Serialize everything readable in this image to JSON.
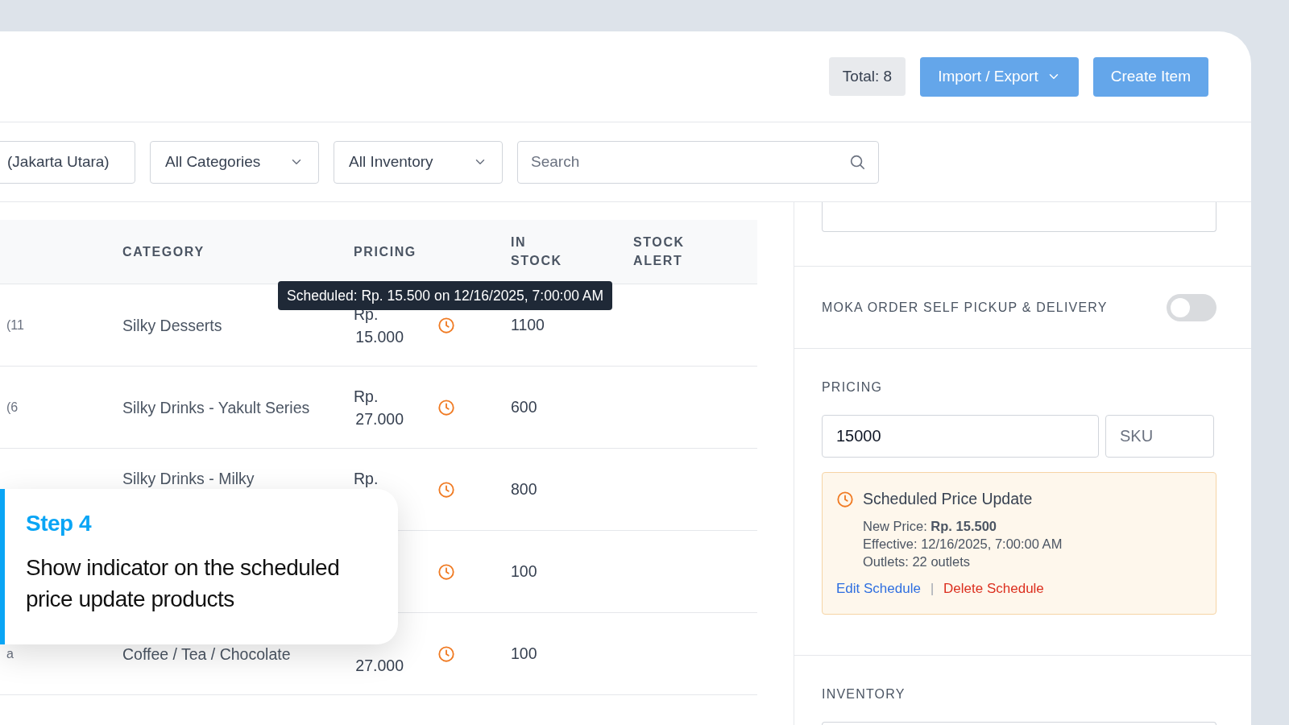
{
  "header": {
    "total": "Total: 8",
    "buttons": [
      {
        "label": "Import / Export",
        "kind": "dropdown"
      },
      {
        "label": "Create Item",
        "kind": "plain"
      }
    ]
  },
  "filters": {
    "selects": [
      {
        "label": "(Jakarta Utara)",
        "kind": "plain"
      },
      {
        "label": "All Categories",
        "kind": "dropdown"
      },
      {
        "label": "All Inventory",
        "kind": "dropdown"
      }
    ],
    "search": {
      "placeholder": "Search"
    }
  },
  "table": {
    "columns": [
      "CATEGORY",
      "PRICING",
      "IN STOCK",
      "STOCK ALERT"
    ],
    "rows": [
      {
        "column_1": "(11",
        "category": "Silky Desserts",
        "pricing": {
          "line_1": "Rp.",
          "line_2": "15.000"
        },
        "scheduled": true,
        "in_stock": "1100"
      },
      {
        "column_1": "(6",
        "category": "Silky Drinks - Yakult Series",
        "pricing": {
          "line_1": "Rp.",
          "line_2": "27.000"
        },
        "scheduled": true,
        "in_stock": "600"
      },
      {
        "category": "Silky Drinks - Milky",
        "pricing": {
          "line_1": "Rp."
        },
        "scheduled": true,
        "in_stock": "800"
      },
      {
        "scheduled": true,
        "in_stock": "100"
      },
      {
        "column_1": "a",
        "category": "Coffee / Tea / Chocolate",
        "pricing": {
          "line_2": "27.000"
        },
        "scheduled": true,
        "in_stock": "100"
      }
    ],
    "tooltip": {
      "text": "Scheduled: Rp. 15.500 on 12/16/2025, 7:00:00 AM"
    }
  },
  "panel": {
    "toggle": {
      "label": "MOKA ORDER SELF PICKUP & DELIVERY",
      "on": false
    },
    "pricing": {
      "label": "PRICING",
      "price_value": "15000",
      "sku_placeholder": "SKU",
      "schedule": {
        "title": "Scheduled Price Update",
        "lines": [
          "New Price: **Rp. 15.500**",
          "Effective: 12/16/2025, 7:00:00 AM",
          "Outlets: 22 outlets"
        ],
        "separator": "|",
        "actions": [
          {
            "label": "Edit Schedule",
            "kind": "edit"
          },
          {
            "label": "Delete Schedule",
            "kind": "delete"
          }
        ]
      }
    },
    "inventory": {
      "label": "INVENTORY"
    }
  },
  "step": {
    "title": "Step 4",
    "text": "Show indicator on the scheduled price update products"
  }
}
